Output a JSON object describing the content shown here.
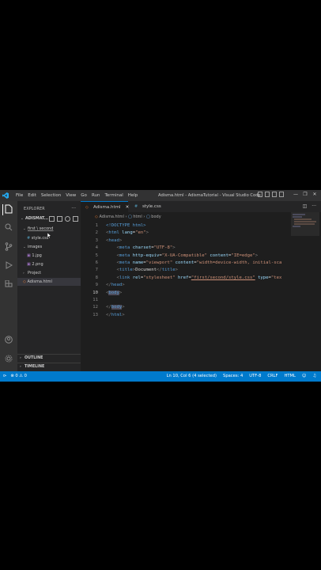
{
  "window": {
    "title": "Adisma.html - AdismaTutorial - Visual Studio Code",
    "menu": [
      "File",
      "Edit",
      "Selection",
      "View",
      "Go",
      "Run",
      "Terminal",
      "Help"
    ],
    "controls": [
      "—",
      "❐",
      "✕"
    ]
  },
  "sidebar": {
    "header": "EXPLORER",
    "more": "···",
    "project": "ADISMAT...",
    "tree": [
      {
        "label": "first \\ second",
        "type": "folder-open",
        "depth": 1
      },
      {
        "label": "style.css",
        "type": "css",
        "depth": 2
      },
      {
        "label": "images",
        "type": "folder-open",
        "depth": 1
      },
      {
        "label": "1.jpg",
        "type": "image",
        "depth": 2
      },
      {
        "label": "2.png",
        "type": "image",
        "depth": 2
      },
      {
        "label": "Project",
        "type": "folder-closed",
        "depth": 1
      },
      {
        "label": "Adisma.html",
        "type": "html",
        "depth": 1
      }
    ],
    "outline": "OUTLINE",
    "timeline": "TIMELINE"
  },
  "tabs": [
    {
      "label": "Adisma.html",
      "close": "✕",
      "active": true
    },
    {
      "label": "style.css",
      "active": false
    }
  ],
  "breadcrumb": [
    "Adisma.html",
    "html",
    "body"
  ],
  "editor": {
    "line_numbers": [
      "1",
      "2",
      "3",
      "4",
      "5",
      "6",
      "7",
      "8",
      "9",
      "10",
      "11",
      "12",
      "13"
    ],
    "current_line": 10,
    "code": {
      "l1_doctype": "<!DOCTYPE html>",
      "l2_html": "html",
      "l2_attr": "lang",
      "l2_val": "\"en\"",
      "l3_head": "head",
      "l4_meta": "meta",
      "l4_attr": "charset",
      "l4_val": "\"UTF-8\"",
      "l5_meta": "meta",
      "l5_attr1": "http-equiv",
      "l5_val1": "\"X-UA-Compatible\"",
      "l5_attr2": "content",
      "l5_val2": "\"IE=edge\"",
      "l6_meta": "meta",
      "l6_attr1": "name",
      "l6_val1": "\"viewport\"",
      "l6_attr2": "content",
      "l6_val2": "\"width=device-width, initial-sca",
      "l7_title": "title",
      "l7_text": "Document",
      "l8_link": "link",
      "l8_attr1": "rel",
      "l8_val1": "\"stylesheet\"",
      "l8_attr2": "href",
      "l8_val2": "\"first/second/style.css\"",
      "l8_attr3": "type",
      "l8_val3": "\"tex",
      "l9_head": "head",
      "l10_body": "body",
      "l12_body": "body",
      "l13_html": "html"
    }
  },
  "statusbar": {
    "errors": "⊗ 0 ⚠ 0",
    "position": "Ln 10, Col 6 (4 selected)",
    "spaces": "Spaces: 4",
    "encoding": "UTF-8",
    "eol": "CRLF",
    "language": "HTML"
  },
  "colors": {
    "accent": "#007acc",
    "tag": "#569cd6",
    "attribute": "#9cdcfe",
    "string": "#ce9178"
  }
}
